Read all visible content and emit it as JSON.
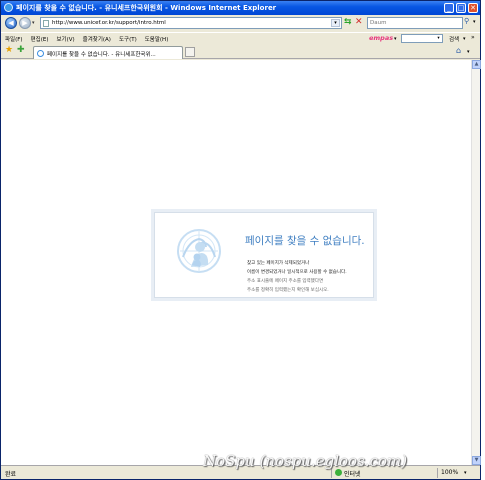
{
  "window": {
    "title": "페이지를 찾을 수 없습니다. - 유니세프한국위원회 - Windows Internet Explorer",
    "minimize": "_",
    "maximize": "□",
    "close": "✕"
  },
  "address": {
    "url": "http://www.unicef.or.kr/support/intro.html",
    "search_placeholder": "Daum"
  },
  "menu": {
    "items": [
      "파일(F)",
      "편집(E)",
      "보기(V)",
      "즐겨찾기(A)",
      "도구(T)",
      "도움말(H)"
    ],
    "empas": "empas",
    "search_label": "검색",
    "more": "»"
  },
  "tab": {
    "label": "페이지를 찾을 수 없습니다. - 유니세프한국위..."
  },
  "error": {
    "title": "페이지를 찾을 수 없습니다.",
    "line1": "찾고 있는 페이지가 삭제되었거나",
    "line2": "이름이 변경되었거나 일시적으로 사용할 수 없습니다.",
    "line3": "주소 표시줄에 페이지 주소를 입력했다면",
    "line4": "주소를 정확히 입력했는지 확인해 보십시오."
  },
  "status": {
    "text": "완료",
    "zone": "인터넷",
    "zoom": "100%"
  },
  "watermark": "NoSpu (nospu.egloos.com)",
  "icons": {
    "back": "back-arrow-icon",
    "forward": "forward-arrow-icon",
    "refresh": "refresh-icon",
    "stop": "stop-icon",
    "search": "search-icon",
    "favorites": "star-icon",
    "add_favorite": "add-favorite-icon",
    "page_menu": "page-icon",
    "ie": "ie-icon",
    "unicef": "unicef-logo"
  },
  "colors": {
    "titlebar": "#0857e3",
    "error_title": "#3e7ec1",
    "logo": "#b9d6f0"
  }
}
